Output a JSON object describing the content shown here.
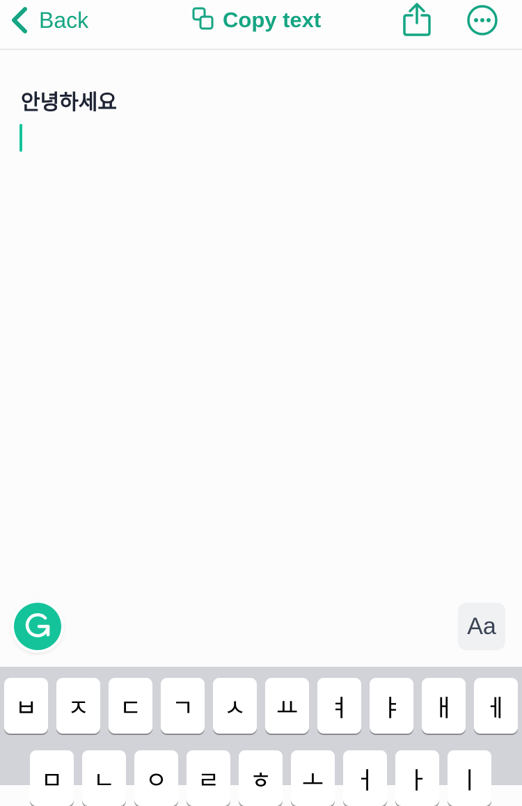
{
  "header": {
    "back_label": "Back",
    "copy_label": "Copy text",
    "icons": {
      "back": "chevron-left-icon",
      "copy": "copy-icon",
      "share": "share-icon",
      "more": "more-icon"
    }
  },
  "editor": {
    "text": "안녕하세요"
  },
  "toolbar": {
    "font_label": "Aa",
    "grammarly_icon": "grammarly-icon"
  },
  "keyboard": {
    "row1": [
      "ㅂ",
      "ㅈ",
      "ㄷ",
      "ㄱ",
      "ㅅ",
      "ㅛ",
      "ㅕ",
      "ㅑ",
      "ㅐ",
      "ㅔ"
    ],
    "row2": [
      "ㅁ",
      "ㄴ",
      "ㅇ",
      "ㄹ",
      "ㅎ",
      "ㅗ",
      "ㅓ",
      "ㅏ",
      "ㅣ"
    ]
  },
  "colors": {
    "accent": "#15a583",
    "grammarly": "#15c39a",
    "text": "#1e2433",
    "keyboard_bg": "#d1d3d9"
  }
}
